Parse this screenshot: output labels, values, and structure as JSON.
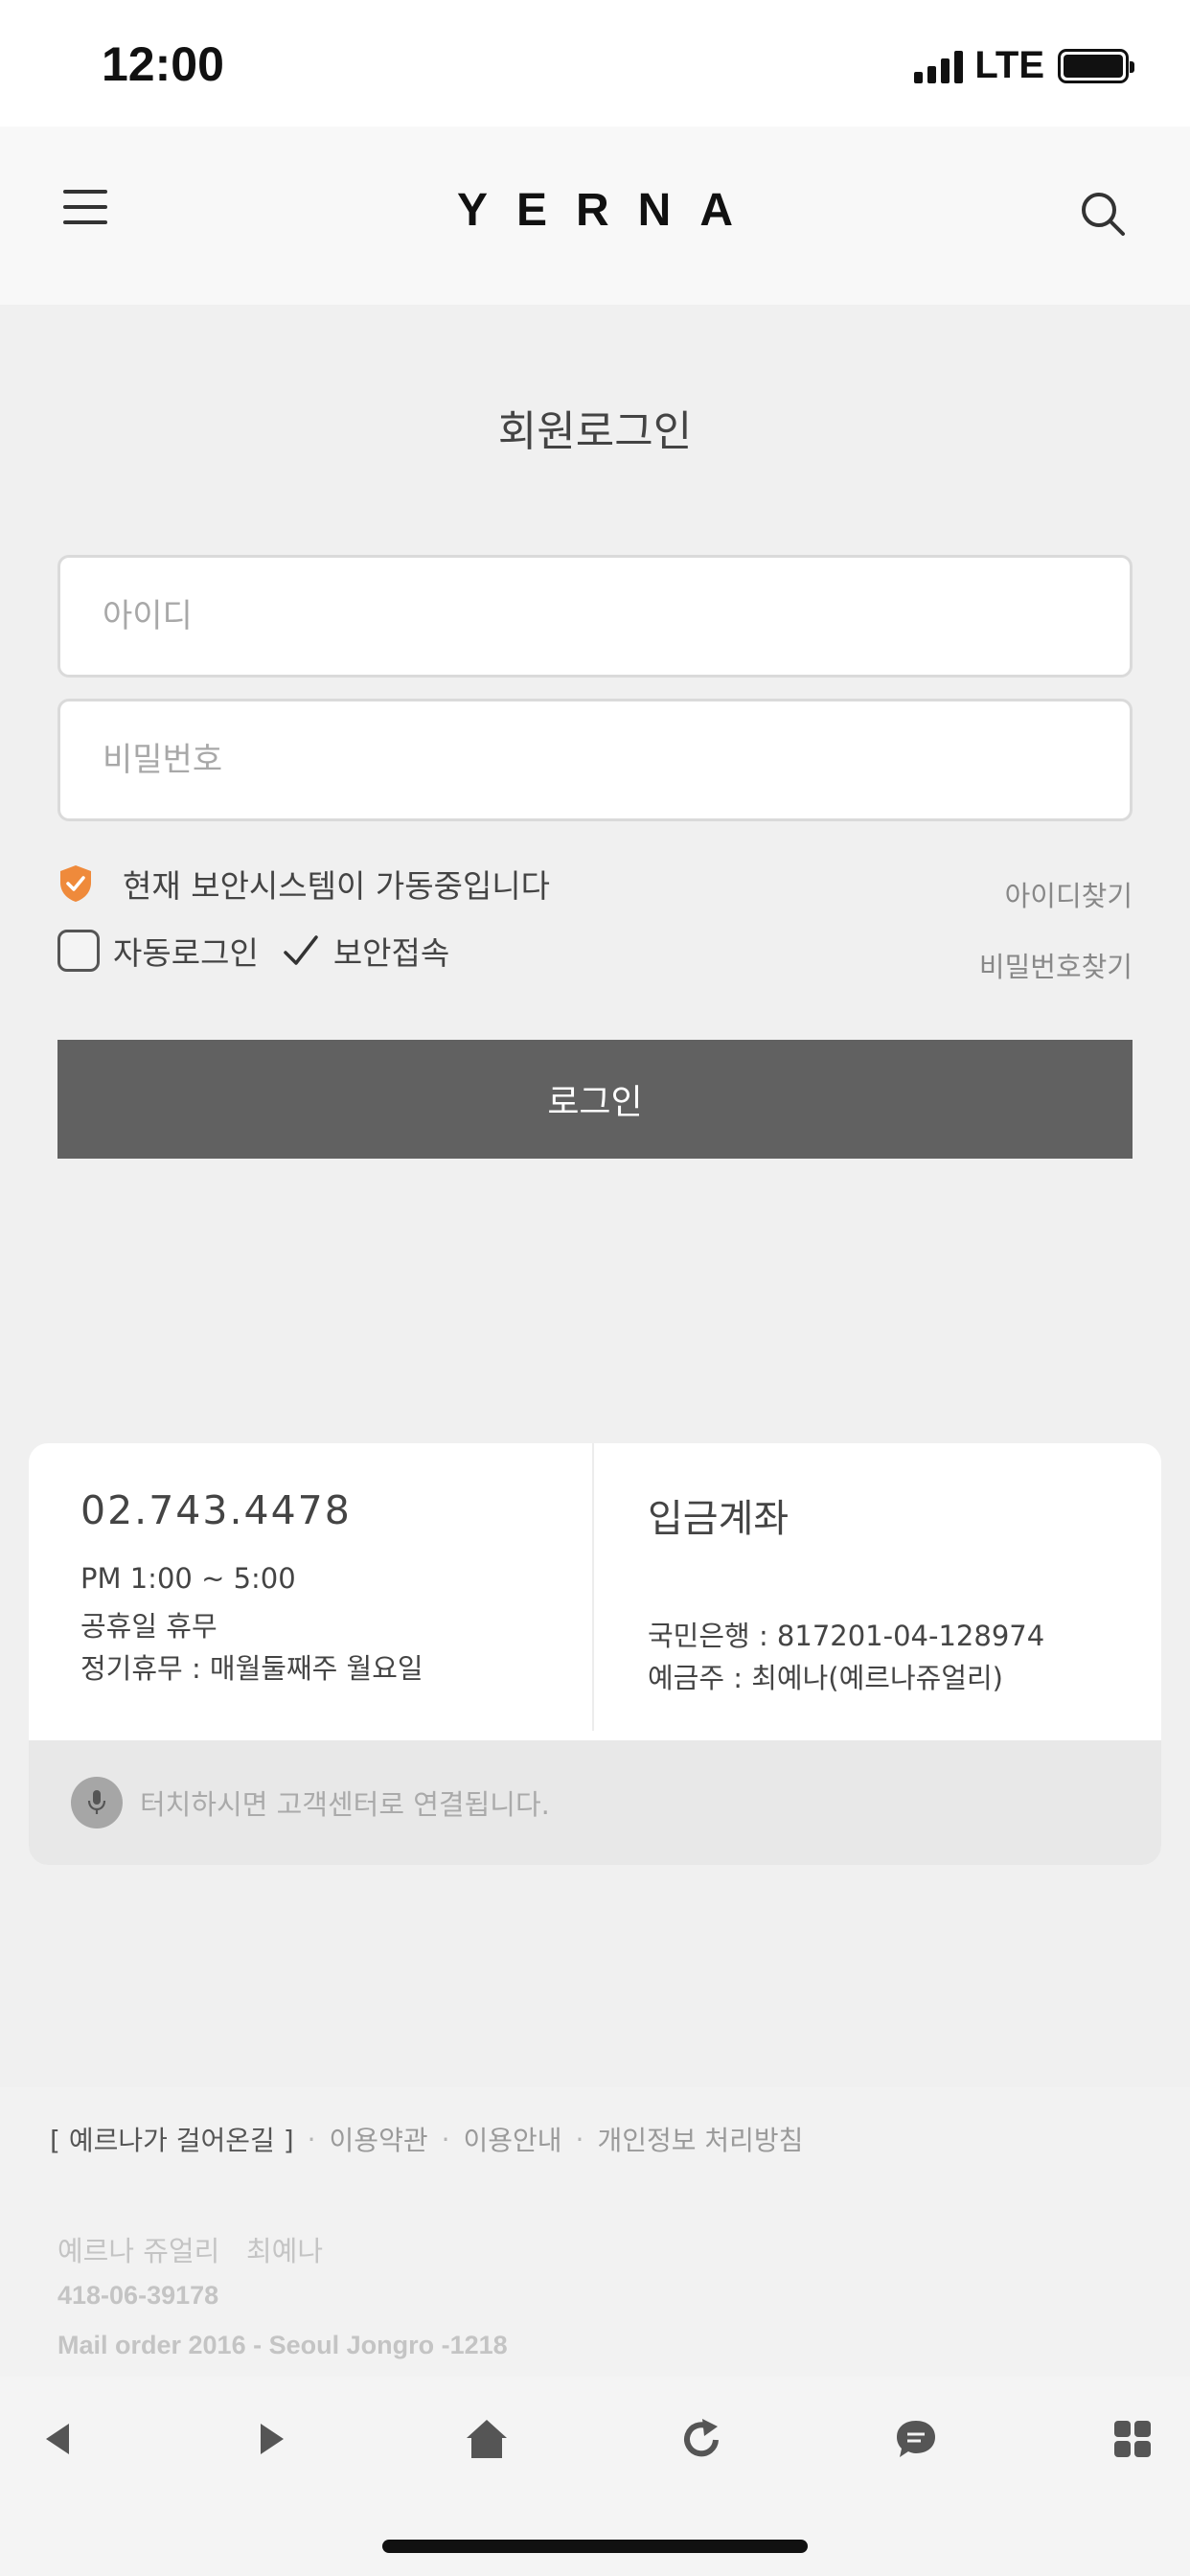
{
  "status_bar": {
    "time": "12:00",
    "network": "LTE"
  },
  "header": {
    "logo": "YERNA"
  },
  "login": {
    "title": "회원로그인",
    "id_placeholder": "아이디",
    "password_placeholder": "비밀번호",
    "security_text": "현재 보안시스템이 가동중입니다",
    "find_id": "아이디찾기",
    "find_password": "비밀번호찾기",
    "auto_login": "자동로그인",
    "secure_access": "보안접속",
    "login_button": "로그인"
  },
  "customer_service": {
    "phone": "02.743.4478",
    "hours": "PM 1:00 ~ 5:00",
    "holiday": "공휴일 휴무",
    "regular_closure": "정기휴무 : 매월둘째주 월요일",
    "account_title": "입금계좌",
    "bank": "국민은행 : 817201-04-128974",
    "holder": "예금주 : 최예나(예르나쥬얼리)",
    "touch_hint": "터치하시면 고객센터로 연결됩니다."
  },
  "footer": {
    "links": [
      "[ 예르나가 걸어온길 ]",
      "이용약관",
      "이용안내",
      "개인정보 처리방침"
    ],
    "company": "예르나 쥬얼리   최예나",
    "business_number": "418-06-39178",
    "mail_order": "Mail order 2016 - Seoul Jongro -1218"
  },
  "icons": {
    "menu": "hamburger-icon",
    "search": "search-icon",
    "security": "shield-icon",
    "mic": "microphone-icon",
    "back": "back-icon",
    "forward": "forward-icon",
    "home": "home-icon",
    "refresh": "refresh-icon",
    "chat": "chat-icon",
    "apps": "apps-grid-icon"
  },
  "colors": {
    "accent_shield": "#ef8a3b",
    "login_button": "#616161",
    "background": "#f0f0f0"
  }
}
